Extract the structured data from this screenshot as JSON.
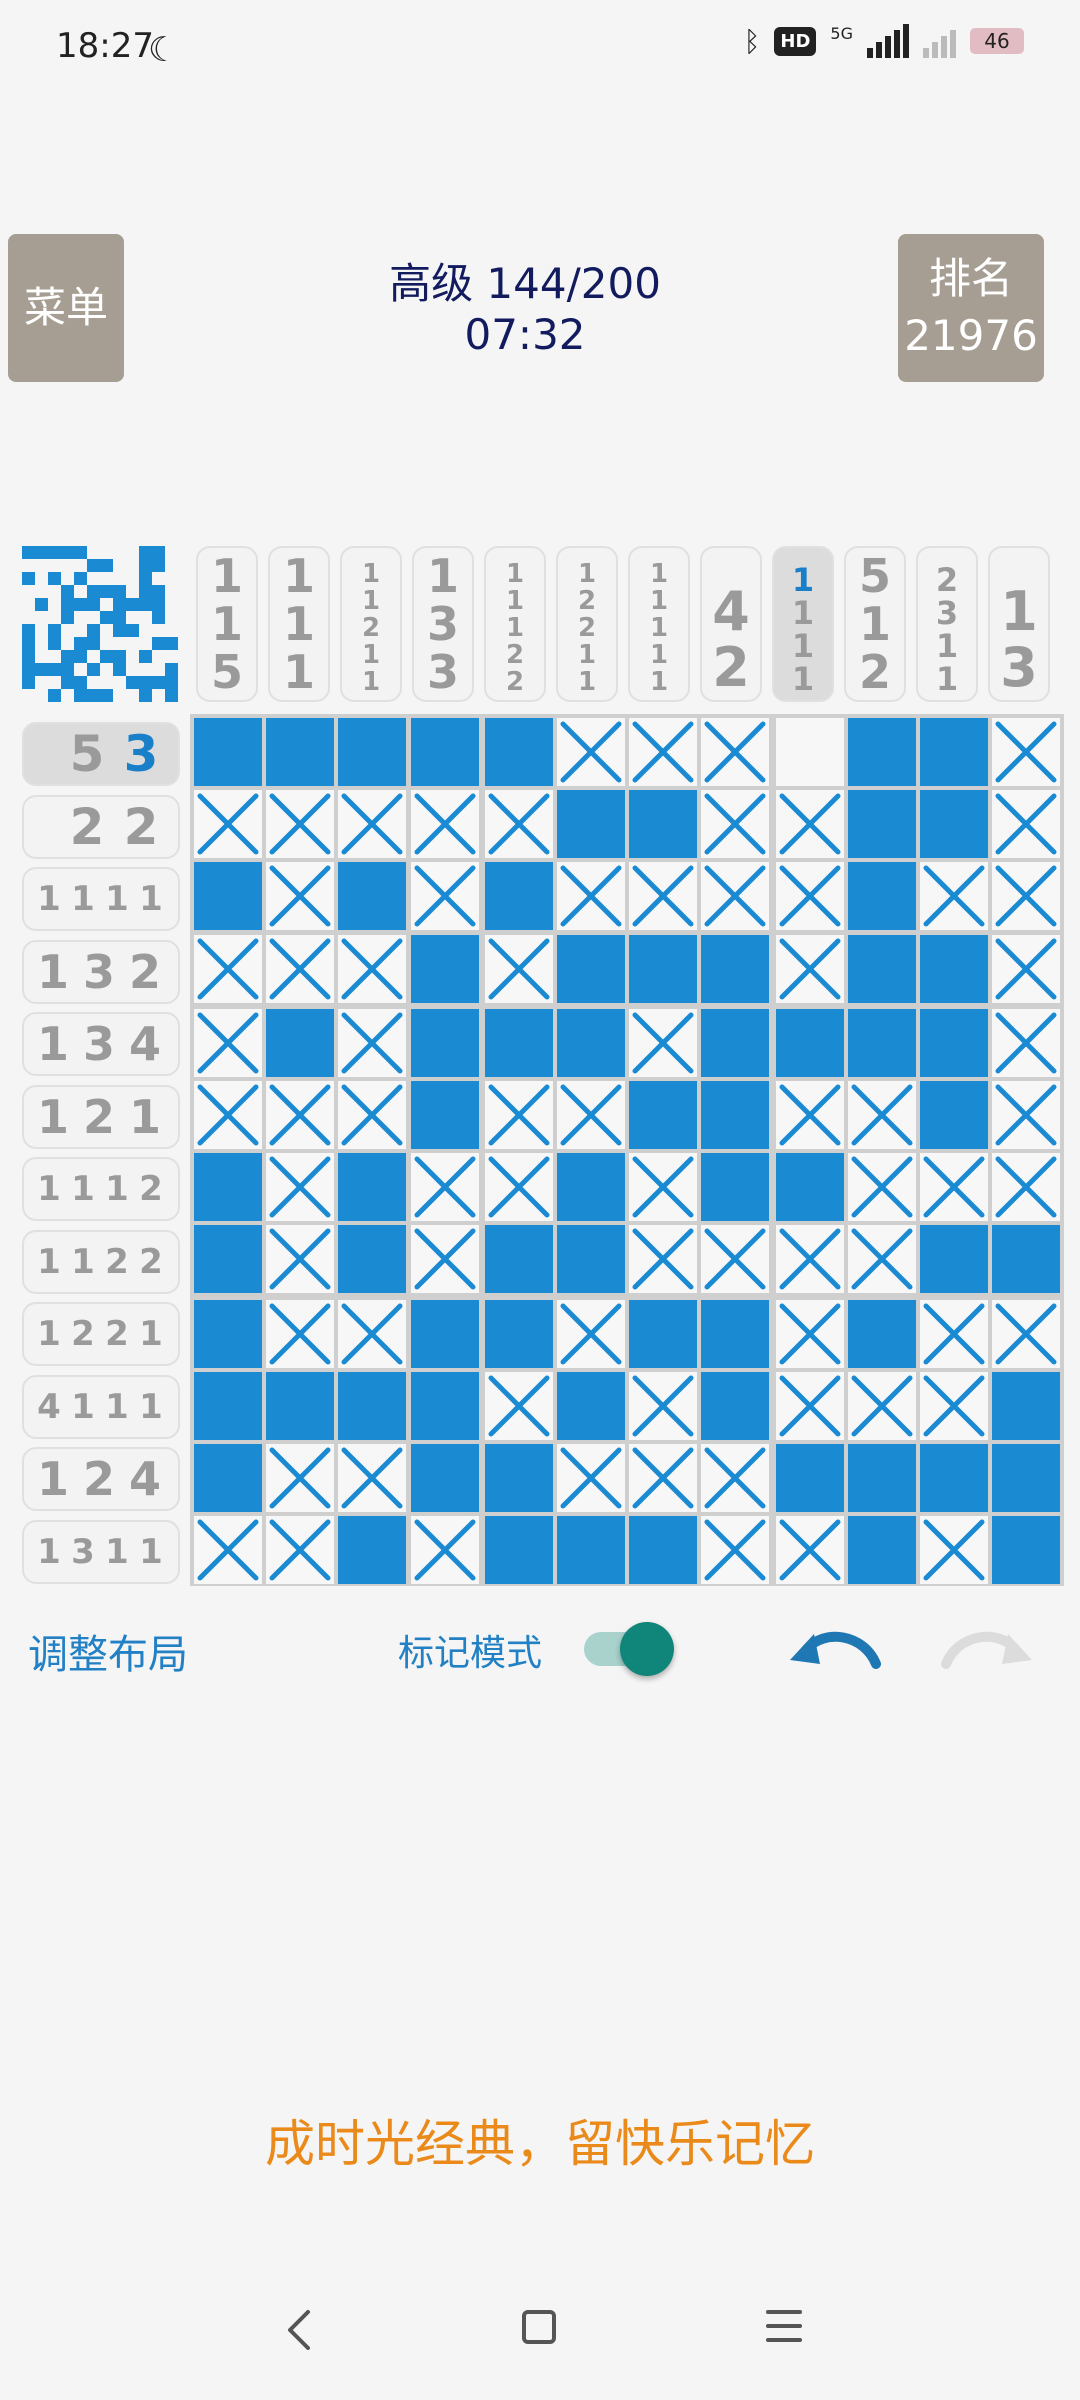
{
  "status": {
    "time": "18:27",
    "network": "5G",
    "hd": "HD",
    "battery": "46"
  },
  "header": {
    "menu_label": "菜单",
    "level": "高级 144/200",
    "timer": "07:32",
    "rank_label": "排名",
    "rank_value": "21976"
  },
  "colors": {
    "filled": "#1a8ad2",
    "cross": "#1a8ad2",
    "accent": "#2280c4",
    "slogan": "#ea8a1a",
    "toggle": "#10857a"
  },
  "preview": [
    [
      1,
      1,
      1,
      1,
      1,
      0,
      0,
      0,
      0,
      1,
      1,
      0
    ],
    [
      0,
      0,
      0,
      0,
      0,
      1,
      1,
      0,
      0,
      1,
      1,
      0
    ],
    [
      1,
      0,
      1,
      0,
      1,
      0,
      0,
      0,
      0,
      1,
      0,
      0
    ],
    [
      0,
      0,
      0,
      1,
      0,
      1,
      1,
      1,
      0,
      1,
      1,
      0
    ],
    [
      0,
      1,
      0,
      1,
      1,
      1,
      0,
      1,
      1,
      1,
      1,
      0
    ],
    [
      0,
      0,
      0,
      1,
      0,
      0,
      1,
      1,
      0,
      0,
      1,
      0
    ],
    [
      1,
      0,
      1,
      0,
      0,
      1,
      0,
      1,
      1,
      0,
      0,
      0
    ],
    [
      1,
      0,
      1,
      0,
      1,
      1,
      0,
      0,
      0,
      0,
      1,
      1
    ],
    [
      1,
      0,
      0,
      1,
      1,
      0,
      1,
      1,
      0,
      1,
      0,
      0
    ],
    [
      1,
      1,
      1,
      1,
      0,
      1,
      0,
      1,
      0,
      0,
      0,
      1
    ],
    [
      1,
      0,
      0,
      1,
      1,
      0,
      0,
      0,
      1,
      1,
      1,
      1
    ],
    [
      0,
      0,
      1,
      0,
      1,
      1,
      1,
      0,
      0,
      1,
      0,
      1
    ]
  ],
  "column_clues": [
    [
      "1",
      "1",
      "5"
    ],
    [
      "1",
      "1",
      "1"
    ],
    [
      "1",
      "1",
      "2",
      "1",
      "1"
    ],
    [
      "1",
      "3",
      "3"
    ],
    [
      "1",
      "1",
      "1",
      "2",
      "2"
    ],
    [
      "1",
      "2",
      "2",
      "1",
      "1"
    ],
    [
      "1",
      "1",
      "1",
      "1",
      "1"
    ],
    [
      "4",
      "2"
    ],
    [
      "1",
      "1",
      "1",
      "1"
    ],
    [
      "5",
      "1",
      "2"
    ],
    [
      "2",
      "3",
      "1",
      "1"
    ],
    [
      "1",
      "3"
    ]
  ],
  "active_column": 8,
  "row_clues": [
    [
      "5",
      "3"
    ],
    [
      "2",
      "2"
    ],
    [
      "1",
      "1",
      "1",
      "1"
    ],
    [
      "1",
      "3",
      "2"
    ],
    [
      "1",
      "3",
      "4"
    ],
    [
      "1",
      "2",
      "1"
    ],
    [
      "1",
      "1",
      "1",
      "2"
    ],
    [
      "1",
      "1",
      "2",
      "2"
    ],
    [
      "1",
      "2",
      "2",
      "1"
    ],
    [
      "4",
      "1",
      "1",
      "1"
    ],
    [
      "1",
      "2",
      "4"
    ],
    [
      "1",
      "3",
      "1",
      "1"
    ]
  ],
  "active_row": 0,
  "board": [
    "FFFFFXXXEFFX",
    "XXXXXFFXXFFX",
    "FXFXFXXXXFXX",
    "XXXFXFFFXFFX",
    "XFXFFFXFFFFX",
    "XXXFXXFFXXFX",
    "FXFXXFXFFXXX",
    "FXFXFFXXXXFF",
    "FXXFFXFFXFXX",
    "FFFFXFXFXXXF",
    "FXXFFXXXFFFF",
    "XXFXFFFXXFXF"
  ],
  "controls": {
    "adjust_layout": "调整布局",
    "mark_mode": "标记模式",
    "mark_mode_on": true
  },
  "slogan": "成时光经典，留快乐记忆",
  "icons": {
    "undo": "undo-arrow-icon",
    "redo": "redo-arrow-icon",
    "back": "nav-back-icon",
    "home": "nav-home-icon",
    "menu": "nav-menu-icon"
  }
}
